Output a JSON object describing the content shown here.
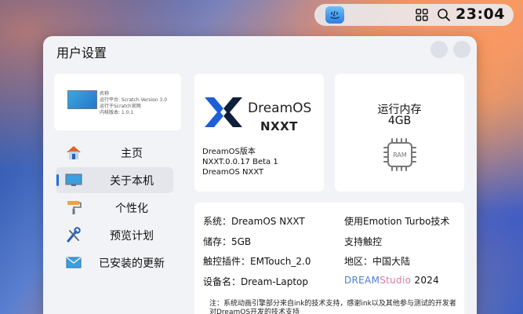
{
  "statusbar": {
    "finder_icon": "finder-face-icon",
    "grid_icon": "grid-icon",
    "search_icon": "search-icon",
    "clock": "23:04"
  },
  "window": {
    "title": "用户设置"
  },
  "preview": {
    "lines": [
      "名称",
      "运行平台: Scratch Version 3.0",
      "运行于Scratch官网",
      "内核版本: 1.0.1"
    ]
  },
  "sidebar": {
    "items": [
      {
        "label": "主页",
        "icon": "home-icon",
        "active": false
      },
      {
        "label": "关于本机",
        "icon": "monitor-icon",
        "active": true
      },
      {
        "label": "个性化",
        "icon": "paint-roller-icon",
        "active": false
      },
      {
        "label": "预览计划",
        "icon": "tools-icon",
        "active": false
      },
      {
        "label": "已安装的更新",
        "icon": "update-mail-icon",
        "active": false
      }
    ]
  },
  "brand": {
    "name": "DreamOS",
    "sub": "NXXT",
    "info": [
      "DreamOS版本",
      "NXXT.0.0.17 Beta 1",
      "DreamOS NXXT"
    ],
    "logo_color": "#1e5fd8"
  },
  "ram": {
    "title": "运行内存",
    "value": "4GB",
    "chip_label": "RAM"
  },
  "details": {
    "system": "系统：DreamOS NXXT",
    "storage": "储存：5GB",
    "touch": "触控插件：EMTouch_2.0",
    "device": "设备名：Dream-Laptop",
    "emotion": "使用Emotion Turbo技术",
    "support": "支持触控",
    "region": "地区：中国大陆",
    "studio_part1": "DREAM",
    "studio_part2": "Studio",
    "studio_part3": " 2024",
    "note": "注：系统动画引擎部分来自ink的技术支持，感谢ink以及其他参与测试的开发者对DreamOS开发的技术支持"
  }
}
